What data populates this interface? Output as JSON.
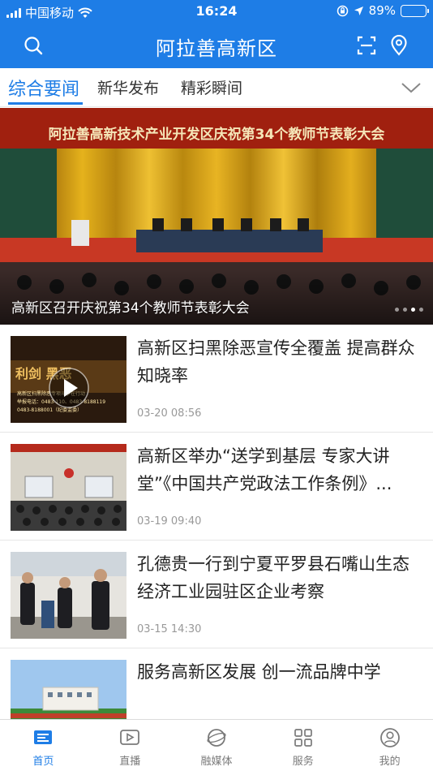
{
  "status_bar": {
    "carrier": "中国移动",
    "time": "16:24",
    "battery_percent_text": "89%",
    "battery_level": 0.89
  },
  "header": {
    "title": "阿拉善高新区",
    "left_icon": "search-icon",
    "right_icons": [
      "scan-icon",
      "location-icon"
    ]
  },
  "tabs": {
    "items": [
      {
        "label": "综合要闻",
        "active": true
      },
      {
        "label": "新华发布",
        "active": false
      },
      {
        "label": "精彩瞬间",
        "active": false
      }
    ],
    "expand_icon": "chevron-down-icon"
  },
  "hero": {
    "banner_text": "阿拉善高新技术产业开发区庆祝第34个教师节表彰大会",
    "caption": "高新区召开庆祝第34个教师节表彰大会",
    "page_count": 4,
    "current_page": 3
  },
  "news": [
    {
      "title": "高新区扫黑除恶宣传全覆盖 提高群众知晓率",
      "date": "03-20 08:56",
      "has_video": true
    },
    {
      "title": "高新区举办“送学到基层 专家大讲堂”《中国共产党政法工作条例》...",
      "date": "03-19 09:40",
      "has_video": false
    },
    {
      "title": "孔德贵一行到宁夏平罗县石嘴山生态经济工业园驻区企业考察",
      "date": "03-15 14:30",
      "has_video": false
    },
    {
      "title": "服务高新区发展 创一流品牌中学",
      "date": "",
      "has_video": false
    }
  ],
  "thumb1_overlay": {
    "line1": "利剑  黑恶",
    "line2": "高新区扫黑除恶专项斗争在行动",
    "line3": "举报电话：0483-110、0483-8188119",
    "line4": "0483-8188001（纪委监委）"
  },
  "bottom_nav": [
    {
      "label": "首页",
      "icon": "home-icon",
      "active": true
    },
    {
      "label": "直播",
      "icon": "live-play-icon",
      "active": false
    },
    {
      "label": "融媒体",
      "icon": "media-globe-icon",
      "active": false
    },
    {
      "label": "服务",
      "icon": "grid-services-icon",
      "active": false
    },
    {
      "label": "我的",
      "icon": "profile-icon",
      "active": false
    }
  ],
  "colors": {
    "brand_blue": "#1e7de6",
    "text_dark": "#222222",
    "text_gray": "#999999"
  }
}
